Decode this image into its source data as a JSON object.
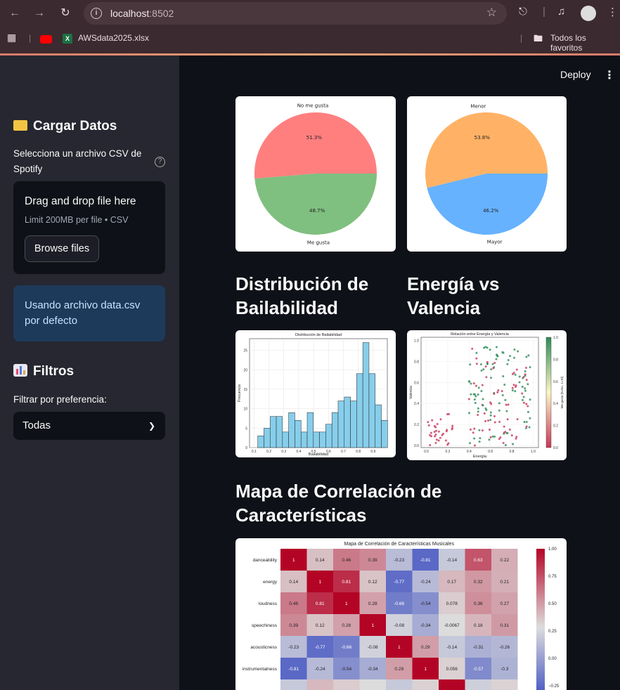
{
  "browser": {
    "url_host": "localhost",
    "url_port": ":8502",
    "bookmarks": [
      "AWSdata2025.xlsx"
    ],
    "all_bookmarks": "Todos los favoritos"
  },
  "header": {
    "deploy": "Deploy"
  },
  "sidebar": {
    "load_title": "Cargar Datos",
    "upload_label": "Selecciona un archivo CSV de Spotify",
    "drop_text": "Drag and drop file here",
    "limit_text": "Limit 200MB per file • CSV",
    "browse": "Browse files",
    "info": "Usando archivo data.csv por defecto",
    "filters_title": "Filtros",
    "filter_label": "Filtrar por preferencia:",
    "filter_value": "Todas"
  },
  "main": {
    "dist_title": "Distribución de Bailabilidad",
    "energy_title": "Energía vs Valencia",
    "corr_title": "Mapa de Correlación de Características"
  },
  "chart_data": [
    {
      "type": "pie",
      "labels": [
        "No me gusta",
        "Me gusta"
      ],
      "values": [
        51.3,
        48.7
      ],
      "pct_labels": [
        "51.3%",
        "48.7%"
      ],
      "colors": [
        "#ff7f7f",
        "#7fbf7f"
      ]
    },
    {
      "type": "pie",
      "labels": [
        "Menor",
        "Mayor"
      ],
      "values": [
        53.8,
        46.2
      ],
      "pct_labels": [
        "53.8%",
        "46.2%"
      ],
      "colors": [
        "#ffb266",
        "#66b2ff"
      ]
    },
    {
      "type": "bar",
      "title": "Distribución de Bailabilidad",
      "xlabel": "Bailabilidad",
      "ylabel": "Frecuencia",
      "bin_start": 0.125,
      "bin_width": 0.0415,
      "values": [
        3,
        5,
        8,
        8,
        4,
        9,
        7,
        4,
        9,
        4,
        4,
        6,
        9,
        12,
        13,
        12,
        19,
        27,
        19,
        11,
        7
      ],
      "ylim": [
        0,
        28
      ],
      "yticks": [
        0,
        5,
        10,
        15,
        20,
        25
      ],
      "xticks": [
        "0.1",
        "0.2",
        "0.3",
        "0.4",
        "0.5",
        "0.6",
        "0.7",
        "0.8",
        "0.9"
      ],
      "color": "#87ceeb",
      "grid": true
    },
    {
      "type": "scatter",
      "title": "Relación entre Energía y Valencia",
      "xlabel": "Energía",
      "ylabel": "Valencia",
      "colorbar_label": "Me gusta (0=No, 1=Sí)",
      "xticks": [
        "0.0",
        "0.2",
        "0.4",
        "0.6",
        "0.8",
        "1.0"
      ],
      "yticks": [
        "0.0",
        "0.2",
        "0.4",
        "0.6",
        "0.8",
        "1.0"
      ],
      "cbar_ticks": [
        "0.0",
        "0.2",
        "0.4",
        "0.6",
        "0.8",
        "1.0"
      ],
      "xlim": [
        -0.05,
        1.05
      ],
      "ylim": [
        -0.02,
        1.03
      ]
    },
    {
      "type": "heatmap",
      "title": "Mapa de Correlación de Características Musicales",
      "rows": [
        "danceability",
        "energy",
        "loudness",
        "speechiness",
        "acousticness",
        "instrumentalness"
      ],
      "values": [
        [
          1,
          0.14,
          0.46,
          0.39,
          -0.23,
          -0.81,
          -0.14,
          0.63,
          0.22
        ],
        [
          0.14,
          1,
          0.81,
          0.12,
          -0.77,
          -0.24,
          0.17,
          0.32,
          0.21
        ],
        [
          0.46,
          0.81,
          1,
          0.28,
          -0.66,
          -0.54,
          0.078,
          0.36,
          0.27
        ],
        [
          0.39,
          0.12,
          0.28,
          1,
          -0.08,
          -0.34,
          -0.0067,
          0.18,
          0.31
        ],
        [
          -0.23,
          -0.77,
          -0.66,
          -0.08,
          1,
          0.29,
          -0.14,
          -0.31,
          -0.26
        ],
        [
          -0.81,
          -0.24,
          -0.54,
          -0.34,
          0.29,
          1,
          0.056,
          -0.57,
          -0.3
        ]
      ],
      "labels": [
        [
          "1",
          "0.14",
          "0.46",
          "0.39",
          "-0.23",
          "-0.81",
          "-0.14",
          "0.63",
          "0.22"
        ],
        [
          "0.14",
          "1",
          "0.81",
          "0.12",
          "-0.77",
          "-0.24",
          "0.17",
          "0.32",
          "0.21"
        ],
        [
          "0.46",
          "0.81",
          "1",
          "0.28",
          "-0.66",
          "-0.54",
          "0.078",
          "0.36",
          "0.27"
        ],
        [
          "0.39",
          "0.12",
          "0.28",
          "1",
          "-0.08",
          "-0.34",
          "-0.0067",
          "0.18",
          "0.31"
        ],
        [
          "-0.23",
          "-0.77",
          "-0.66",
          "-0.08",
          "1",
          "0.29",
          "-0.14",
          "-0.31",
          "-0.26"
        ],
        [
          "-0.81",
          "-0.24",
          "-0.54",
          "-0.34",
          "0.29",
          "1",
          "0.056",
          "-0.57",
          "-0.3"
        ]
      ],
      "cbar_ticks": [
        "1.00",
        "0.75",
        "0.50",
        "0.25",
        "0.00",
        "−0.25"
      ]
    }
  ]
}
